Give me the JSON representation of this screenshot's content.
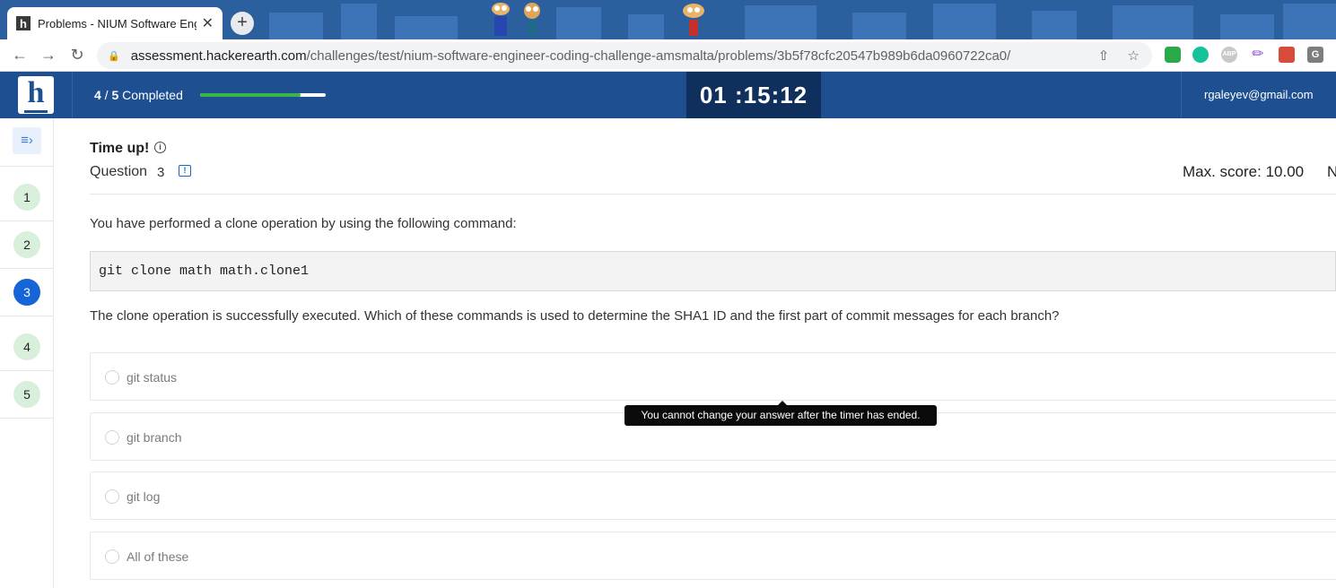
{
  "browser": {
    "tab_title": "Problems - NIUM Software Eng",
    "favicon_letter": "h",
    "close_glyph": "✕",
    "new_tab_glyph": "+",
    "url_host": "assessment.hackerearth.com",
    "url_path": "/challenges/test/nium-software-engineer-coding-challenge-amsmalta/problems/3b5f78cfc20547b989b6da0960722ca0/",
    "extension_abp": "ABP",
    "extension_g": "G"
  },
  "header": {
    "logo_letter": "h",
    "progress_done": "4",
    "progress_total": "5",
    "progress_label": "Completed",
    "progress_fraction": 0.8,
    "timer": "01 :15:12",
    "email": "rgaleyev@gmail.com"
  },
  "sidebar": {
    "questions": [
      "1",
      "2",
      "3",
      "4",
      "5"
    ],
    "active_question": "3"
  },
  "main": {
    "status": "Time up!",
    "question_label": "Question",
    "question_number": "3",
    "max_score": "Max. score: 10.00",
    "cutoff_letter": "N",
    "question_text": "You have performed a clone operation by using the following command:",
    "code": "git clone math math.clone1",
    "question_text_2": "The clone operation is successfully executed. Which of these commands is used to determine the SHA1 ID and the first part of commit messages for each branch?",
    "options": [
      "git status",
      "git branch",
      "git log",
      "All of these"
    ],
    "tooltip": "You cannot change your answer after the timer has ended."
  },
  "colors": {
    "header_bg": "#1d4f91",
    "timer_bg": "#0f2f5c",
    "accent": "#1565d8",
    "progress": "#3bb54a"
  }
}
